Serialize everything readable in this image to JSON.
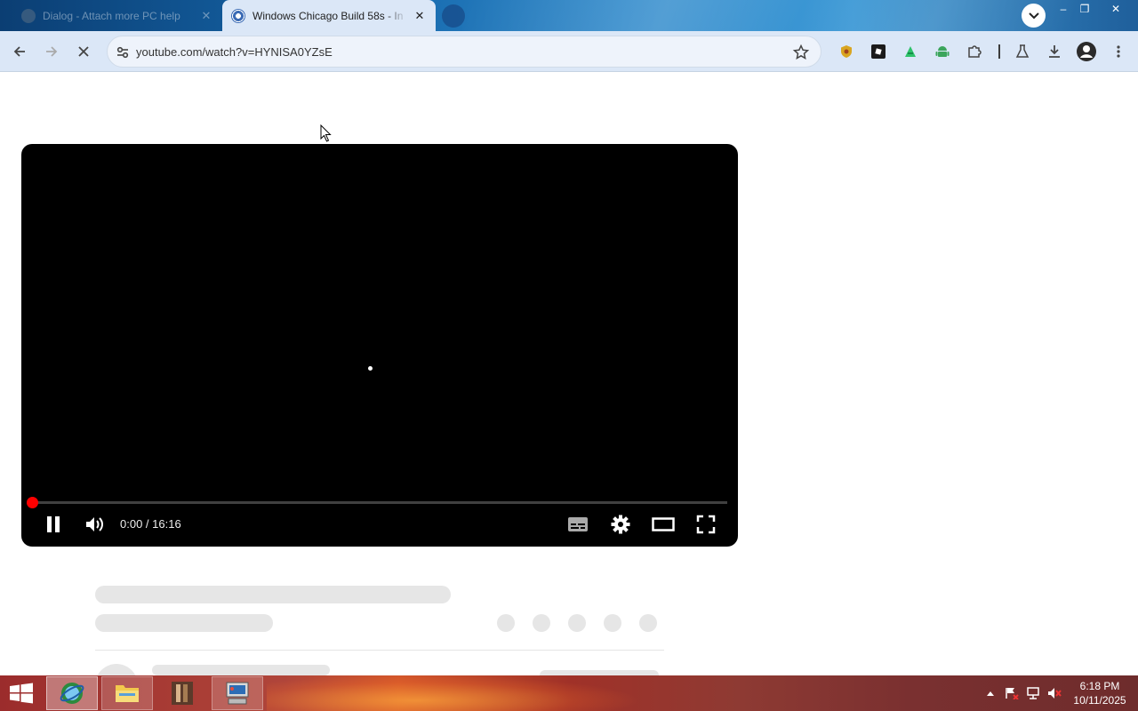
{
  "browser": {
    "tabs": [
      {
        "title": "Dialog - Attach more PC help",
        "active": false
      },
      {
        "title": "Windows Chicago Build 58s - In",
        "active": true
      }
    ],
    "address_bar": {
      "url": "youtube.com/watch?v=HYNISA0YZsE"
    },
    "window_controls": {
      "minimize": "–",
      "restore": "❐",
      "close": "✕"
    },
    "tab_close_glyph": "✕"
  },
  "player": {
    "time_current": "0:00",
    "time_separator": " / ",
    "time_total": "16:16",
    "progress_fraction": 0.0,
    "state": "playing",
    "accent_color": "#ff0000"
  },
  "taskbar": {
    "apps": [
      "internet-explorer",
      "file-explorer",
      "media-app",
      "computer-app"
    ],
    "clock": {
      "time": "6:18 PM",
      "date": "10/11/2025"
    }
  }
}
